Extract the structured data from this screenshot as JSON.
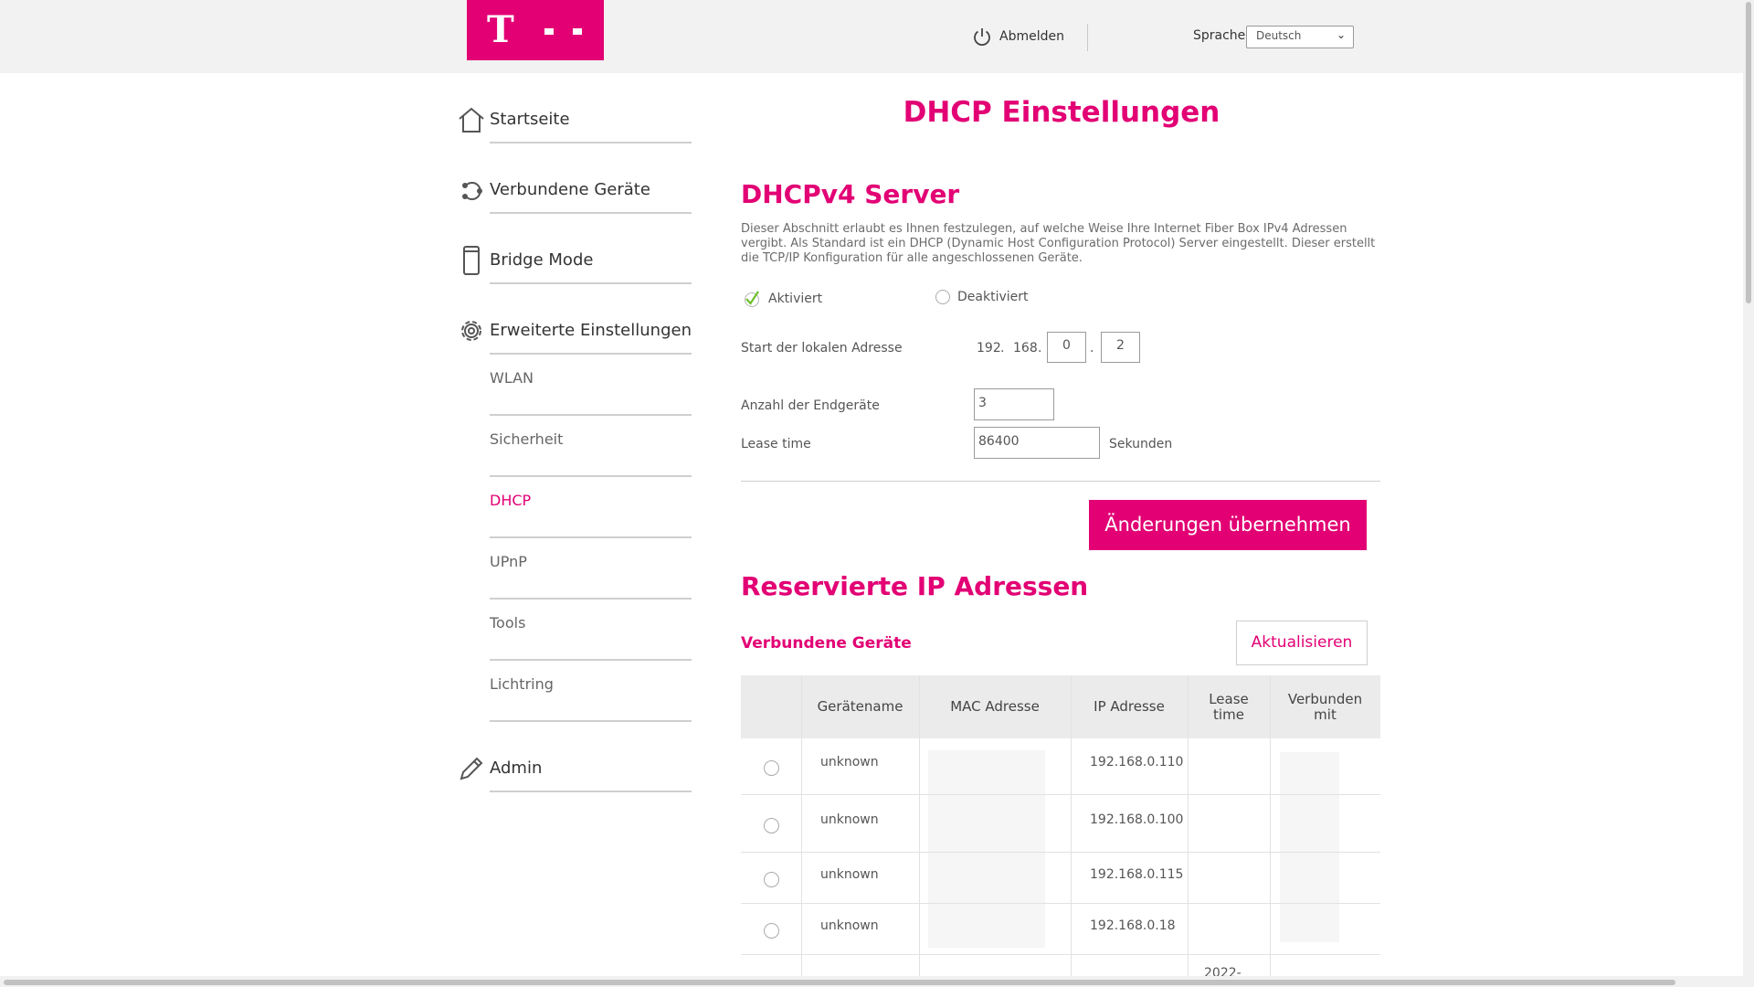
{
  "header": {
    "logout_label": "Abmelden",
    "language_label": "Sprache",
    "language_value": "Deutsch"
  },
  "sidebar": {
    "main_items": [
      {
        "label": "Startseite",
        "icon": "home-icon"
      },
      {
        "label": "Verbundene Geräte",
        "icon": "devices-icon"
      },
      {
        "label": "Bridge Mode",
        "icon": "bridge-icon"
      },
      {
        "label": "Erweiterte Einstellungen",
        "icon": "gear-icon"
      },
      {
        "label": "Admin",
        "icon": "pencil-icon"
      }
    ],
    "sub_items": [
      {
        "label": "WLAN",
        "active": false
      },
      {
        "label": "Sicherheit",
        "active": false
      },
      {
        "label": "DHCP",
        "active": true
      },
      {
        "label": "UPnP",
        "active": false
      },
      {
        "label": "Tools",
        "active": false
      },
      {
        "label": "Lichtring",
        "active": false
      }
    ]
  },
  "main": {
    "title": "DHCP Einstellungen",
    "dhcp_section": {
      "title": "DHCPv4 Server",
      "description": "Dieser Abschnitt erlaubt es Ihnen festzulegen, auf welche Weise Ihre Internet Fiber Box IPv4 Adressen vergibt. Als Standard ist ein DHCP (Dynamic Host Configuration Protocol) Server eingestellt. Dieser erstellt die TCP/IP Konfiguration für alle angeschlossenen Geräte.",
      "option_enabled": "Aktiviert",
      "option_disabled": "Deaktiviert",
      "selected": "Aktiviert",
      "start_address_label": "Start der lokalen Adresse",
      "ip_octet1": "192",
      "ip_octet2": "168",
      "ip_octet3": "0",
      "ip_octet4": "2",
      "device_count_label": "Anzahl der Endgeräte",
      "device_count_value": "3",
      "lease_time_label": "Lease time",
      "lease_time_value": "86400",
      "lease_time_unit": "Sekunden",
      "apply_button": "Änderungen übernehmen"
    },
    "reserved_section": {
      "title": "Reservierte IP Adressen",
      "subtitle": "Verbundene Geräte",
      "refresh_button": "Aktualisieren",
      "table": {
        "headers": [
          "",
          "Gerätename",
          "MAC Adresse",
          "IP Adresse",
          "Lease time",
          "Verbunden mit"
        ],
        "rows": [
          {
            "name": "unknown",
            "mac": "",
            "ip": "192.168.0.110",
            "lease": "",
            "connected": ""
          },
          {
            "name": "unknown",
            "mac": "",
            "ip": "192.168.0.100",
            "lease": "",
            "connected": ""
          },
          {
            "name": "unknown",
            "mac": "",
            "ip": "192.168.0.115",
            "lease": "",
            "connected": ""
          },
          {
            "name": "unknown",
            "mac": "",
            "ip": "192.168.0.18",
            "lease": "",
            "connected": ""
          },
          {
            "name": "",
            "mac": "",
            "ip": "",
            "lease": "2022-",
            "connected": ""
          }
        ]
      }
    }
  },
  "colors": {
    "brand": "#e20074",
    "header_bg": "#f2f2f2",
    "table_header_bg": "#ebebeb",
    "check": "#6bbf2a"
  }
}
